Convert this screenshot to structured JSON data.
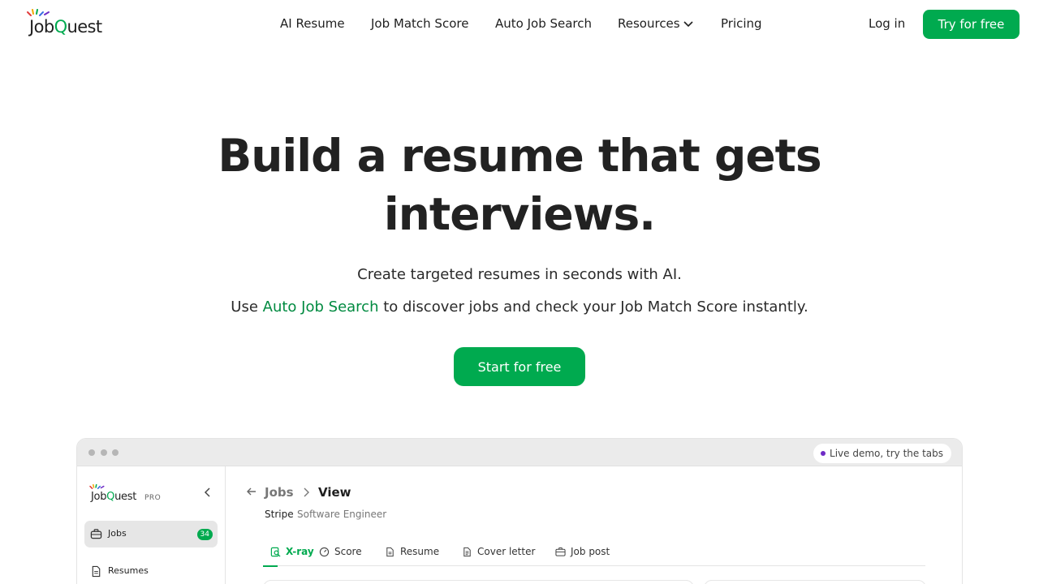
{
  "header": {
    "logo_prefix": "Job",
    "logo_q": "Q",
    "logo_suffix": "uest",
    "nav": {
      "ai_resume": "AI Resume",
      "job_match_score": "Job Match Score",
      "auto_job_search": "Auto Job Search",
      "resources": "Resources",
      "pricing": "Pricing"
    },
    "login": "Log in",
    "try_button": "Try for free"
  },
  "hero": {
    "title_line1": "Build a resume that gets",
    "title_line2": "interviews.",
    "subtitle1": "Create targeted resumes in seconds with AI.",
    "subtitle2_prefix": "Use ",
    "subtitle2_link": "Auto Job Search",
    "subtitle2_suffix": " to discover jobs and check your Job Match Score instantly.",
    "cta": "Start for free"
  },
  "demo": {
    "live_label": "Live demo, try the tabs",
    "sidebar": {
      "logo_prefix": "Job",
      "logo_q": "Q",
      "logo_suffix": "uest",
      "pro": "PRO",
      "items": [
        {
          "label": "Jobs",
          "badge": "34"
        },
        {
          "label": "Resumes"
        }
      ]
    },
    "breadcrumb": {
      "jobs": "Jobs",
      "view": "View"
    },
    "company": "Stripe",
    "role": "Software Engineer",
    "tabs": [
      {
        "label": "X-ray",
        "icon": "xray-icon"
      },
      {
        "label": "Score",
        "icon": "gauge-icon"
      },
      {
        "label": "Resume",
        "icon": "document-icon"
      },
      {
        "label": "Cover letter",
        "icon": "letter-icon"
      },
      {
        "label": "Job post",
        "icon": "briefcase-icon"
      }
    ]
  },
  "colors": {
    "brand_green": "#00aa4f",
    "link_green": "#008a40",
    "live_dot_purple": "#6f2bc6"
  }
}
